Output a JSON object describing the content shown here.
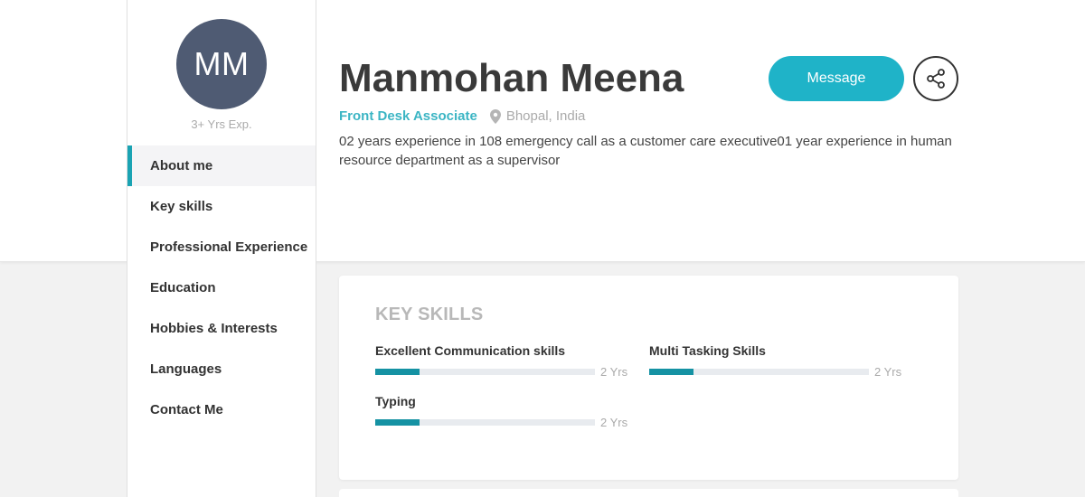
{
  "profile": {
    "initials": "MM",
    "experience": "3+ Yrs Exp.",
    "name": "Manmohan Meena",
    "role": "Front Desk Associate",
    "location": "Bhopal, India",
    "about": "02 years experience in 108 emergency call as a customer care executive01 year experience in human resource department as a supervisor",
    "message_label": "Message",
    "share_icon": "share-icon",
    "location_icon": "map-pin-icon"
  },
  "sidebar": {
    "items": [
      {
        "label": "About me",
        "active": true
      },
      {
        "label": "Key skills",
        "active": false
      },
      {
        "label": "Professional Experience",
        "active": false
      },
      {
        "label": "Education",
        "active": false
      },
      {
        "label": "Hobbies & Interests",
        "active": false
      },
      {
        "label": "Languages",
        "active": false
      },
      {
        "label": "Contact Me",
        "active": false
      }
    ]
  },
  "key_skills": {
    "title": "KEY SKILLS",
    "skills": [
      {
        "name": "Excellent Communication skills",
        "years": "2 Yrs",
        "level": 0.2
      },
      {
        "name": "Multi Tasking Skills",
        "years": "2 Yrs",
        "level": 0.2
      },
      {
        "name": "Typing",
        "years": "2 Yrs",
        "level": 0.2
      }
    ]
  },
  "colors": {
    "accent": "#1aa3b3",
    "button": "#1fb3c8",
    "avatar": "#4f5b73",
    "bar_fill": "#1592a3"
  }
}
